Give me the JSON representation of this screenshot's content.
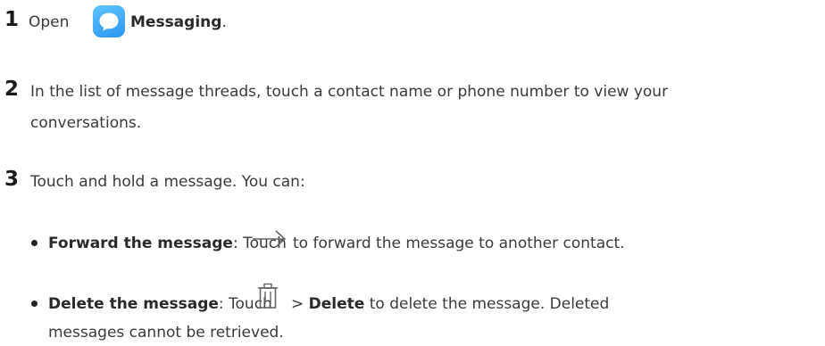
{
  "steps": [
    {
      "number": "1",
      "text_before": "Open",
      "app_name": "Messaging",
      "text_after": "."
    },
    {
      "number": "2",
      "line1": "In the list of message threads, touch a contact name or phone number to view your",
      "line2": "conversations."
    },
    {
      "number": "3",
      "text": "Touch and hold a message. You can:"
    }
  ],
  "options": [
    {
      "title": "Forward the message",
      "sep": ": Touch",
      "icon": "arrow-right-icon",
      "desc": "to forward the message to another contact."
    },
    {
      "title": "Delete the message",
      "sep": ": Touch",
      "icon": "trash-icon",
      "arrow": ">",
      "action": "Delete",
      "desc_line1": "to delete the message. Deleted",
      "desc_line2": "messages cannot be retrieved."
    }
  ],
  "icon_colors": {
    "messaging_app": "#2b97f2",
    "glyphs": "#666666"
  }
}
